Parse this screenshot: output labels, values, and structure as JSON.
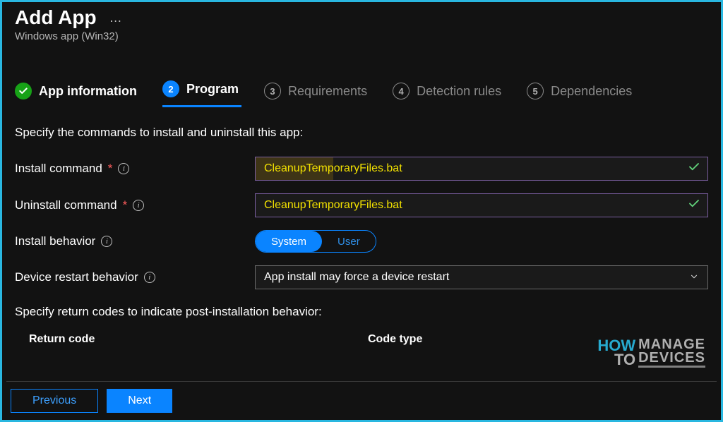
{
  "header": {
    "title": "Add App",
    "more": "…",
    "subtitle": "Windows app (Win32)"
  },
  "steps": [
    {
      "num": "✓",
      "label": "App information",
      "state": "done"
    },
    {
      "num": "2",
      "label": "Program",
      "state": "active"
    },
    {
      "num": "3",
      "label": "Requirements",
      "state": "pending"
    },
    {
      "num": "4",
      "label": "Detection rules",
      "state": "pending"
    },
    {
      "num": "5",
      "label": "Dependencies",
      "state": "pending"
    }
  ],
  "desc": "Specify the commands to install and uninstall this app:",
  "fields": {
    "install_command": {
      "label": "Install command",
      "required": "*",
      "value": "CleanupTemporaryFiles.bat"
    },
    "uninstall_command": {
      "label": "Uninstall command",
      "required": "*",
      "value": "CleanupTemporaryFiles.bat"
    },
    "install_behavior": {
      "label": "Install behavior",
      "option_system": "System",
      "option_user": "User"
    },
    "restart_behavior": {
      "label": "Device restart behavior",
      "value": "App install may force a device restart"
    }
  },
  "section2": "Specify return codes to indicate post-installation behavior:",
  "table": {
    "col1": "Return code",
    "col2": "Code type"
  },
  "footer": {
    "previous": "Previous",
    "next": "Next"
  },
  "watermark": {
    "how": "HOW",
    "to": "TO",
    "manage": "MANAGE",
    "devices": "DEVICES"
  }
}
